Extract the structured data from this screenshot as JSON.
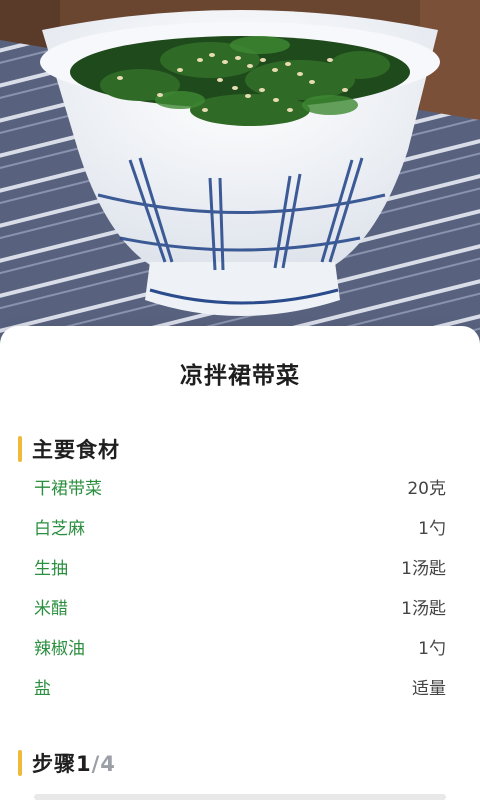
{
  "recipe": {
    "title": "凉拌裙带菜",
    "hero_image": "seaweed-salad-in-striped-bowl"
  },
  "ingredients_section": {
    "title": "主要食材",
    "items": [
      {
        "name": "干裙带菜",
        "amount": "20克"
      },
      {
        "name": "白芝麻",
        "amount": "1勺"
      },
      {
        "name": "生抽",
        "amount": "1汤匙"
      },
      {
        "name": "米醋",
        "amount": "1汤匙"
      },
      {
        "name": "辣椒油",
        "amount": "1勺"
      },
      {
        "name": "盐",
        "amount": "适量"
      }
    ]
  },
  "steps_section": {
    "label": "步骤",
    "current": "1",
    "total": "/4"
  },
  "colors": {
    "accent_bar": "#f0b93a",
    "ingredient_name": "#2b8f3f",
    "bowl_stripe": "#2a4b8c"
  }
}
